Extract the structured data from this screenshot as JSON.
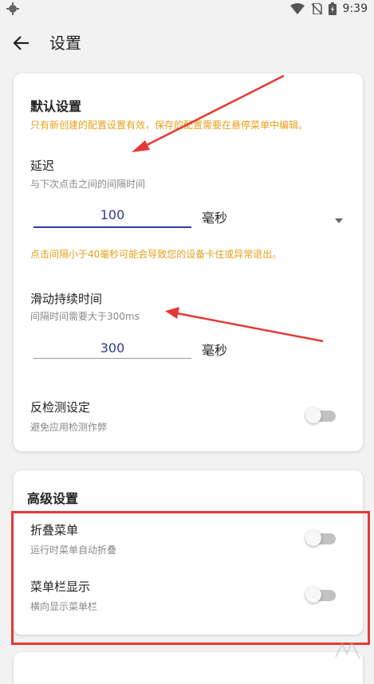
{
  "status": {
    "time": "9:39"
  },
  "appbar": {
    "title": "设置"
  },
  "default_settings": {
    "title": "默认设置",
    "note": "只有新创建的配置设置有效，保存的配置需要在悬停菜单中编辑。",
    "delay": {
      "title": "延迟",
      "subtitle": "与下次点击之间的间隔时间",
      "value": "100",
      "unit": "毫秒",
      "warning": "点击间隔小于40毫秒可能会导致您的设备卡住或异常退出。"
    },
    "swipe": {
      "title": "滑动持续时间",
      "subtitle": "间隔时间需要大于300ms",
      "value": "300",
      "unit": "毫秒"
    },
    "anti_detect": {
      "title": "反检测设定",
      "subtitle": "避免应用检测作弊",
      "enabled": false
    }
  },
  "advanced_settings": {
    "title": "高级设置",
    "fold_menu": {
      "title": "折叠菜单",
      "subtitle": "运行时菜单自动折叠",
      "enabled": false
    },
    "menu_bar": {
      "title": "菜单栏显示",
      "subtitle": "横向显示菜单栏",
      "enabled": false
    }
  },
  "colors": {
    "accent": "#2f3a98",
    "note": "#e6a11b",
    "annotation": "#e53935"
  }
}
